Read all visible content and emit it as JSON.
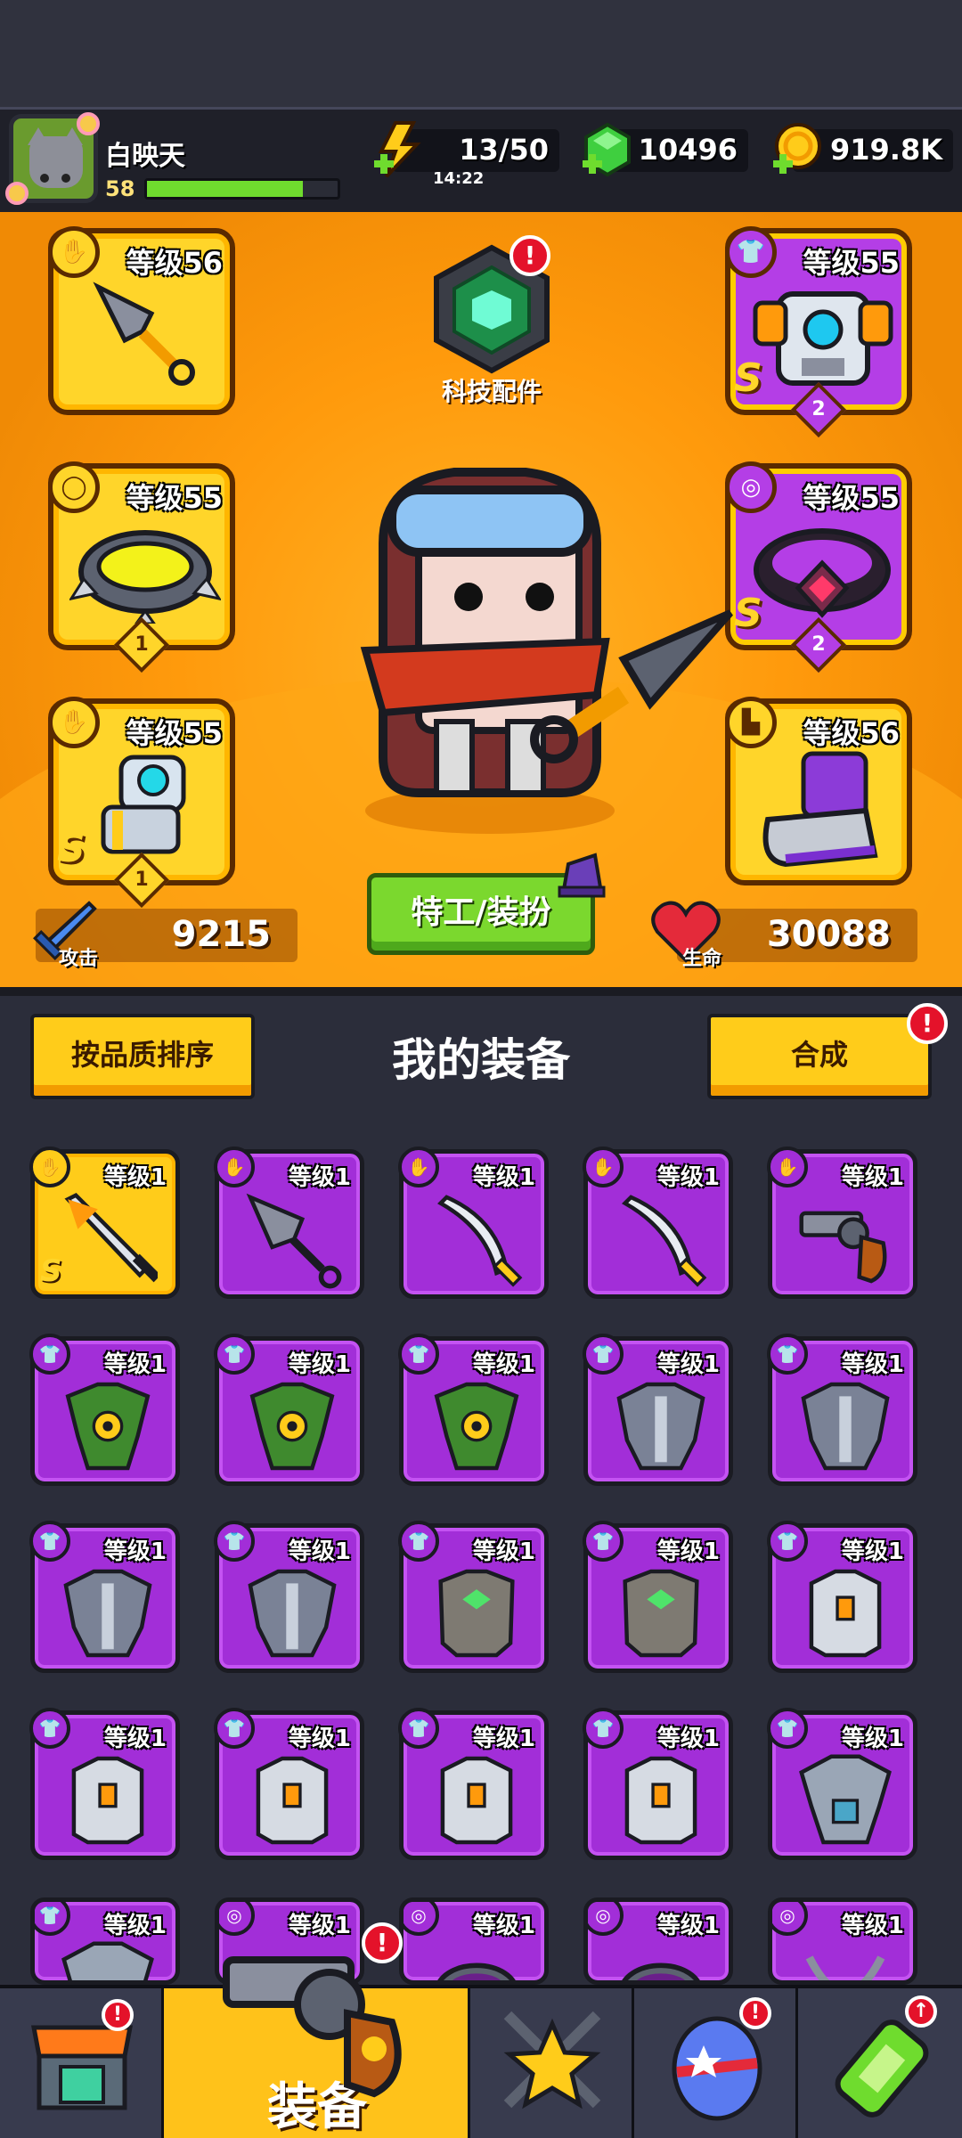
{
  "player": {
    "name": "白映天",
    "level": "58",
    "xp_progress": 0.82
  },
  "resources": {
    "energy": {
      "value": "13/50",
      "timer": "14:22",
      "icon": "lightning-icon"
    },
    "gems": {
      "value": "10496",
      "icon": "gem-icon"
    },
    "coins": {
      "value": "919.8K",
      "icon": "coin-icon"
    }
  },
  "equipped": {
    "weapon": {
      "level": "等级56",
      "icon": "kunai-icon"
    },
    "ring": {
      "level": "等级55",
      "icon": "spiked-ring-icon",
      "stars": "1"
    },
    "glove": {
      "level": "等级55",
      "icon": "gauntlet-icon",
      "rank": "S",
      "stars": "1"
    },
    "armor": {
      "level": "等级55",
      "icon": "mech-armor-icon",
      "rank": "S",
      "stars": "2"
    },
    "belt": {
      "level": "等级55",
      "icon": "gem-belt-icon",
      "rank": "S",
      "stars": "2"
    },
    "boots": {
      "level": "等级56",
      "icon": "boot-icon"
    }
  },
  "tech": {
    "label": "科技配件",
    "alert": "!"
  },
  "stats": {
    "attack_label": "攻击",
    "attack": "9215",
    "hp_label": "生命",
    "hp": "30088"
  },
  "agent_button": "特工/装扮",
  "inventory": {
    "sort_button": "按品质排序",
    "title": "我的装备",
    "merge_button": "合成",
    "merge_alert": "!",
    "items": [
      {
        "lv": "等级1",
        "icon": "sword-icon",
        "rank": "S",
        "quality": "gold"
      },
      {
        "lv": "等级1",
        "icon": "kunai-icon",
        "quality": "purple"
      },
      {
        "lv": "等级1",
        "icon": "scimitar-icon",
        "quality": "purple"
      },
      {
        "lv": "等级1",
        "icon": "scimitar-icon",
        "quality": "purple"
      },
      {
        "lv": "等级1",
        "icon": "revolver-icon",
        "quality": "purple"
      },
      {
        "lv": "等级1",
        "icon": "dragon-armor-icon",
        "quality": "purple"
      },
      {
        "lv": "等级1",
        "icon": "dragon-armor-icon",
        "quality": "purple"
      },
      {
        "lv": "等级1",
        "icon": "dragon-armor-icon",
        "quality": "purple"
      },
      {
        "lv": "等级1",
        "icon": "steel-armor-icon",
        "quality": "purple"
      },
      {
        "lv": "等级1",
        "icon": "steel-armor-icon",
        "quality": "purple"
      },
      {
        "lv": "等级1",
        "icon": "steel-armor-icon",
        "quality": "purple"
      },
      {
        "lv": "等级1",
        "icon": "steel-armor-icon",
        "quality": "purple"
      },
      {
        "lv": "等级1",
        "icon": "stone-armor-icon",
        "quality": "purple"
      },
      {
        "lv": "等级1",
        "icon": "stone-armor-icon",
        "quality": "purple"
      },
      {
        "lv": "等级1",
        "icon": "vest-icon",
        "quality": "purple"
      },
      {
        "lv": "等级1",
        "icon": "vest-icon",
        "quality": "purple"
      },
      {
        "lv": "等级1",
        "icon": "vest-icon",
        "quality": "purple"
      },
      {
        "lv": "等级1",
        "icon": "vest-icon",
        "quality": "purple"
      },
      {
        "lv": "等级1",
        "icon": "vest-icon",
        "quality": "purple"
      },
      {
        "lv": "等级1",
        "icon": "plate-armor-icon",
        "quality": "purple"
      },
      {
        "lv": "等级1",
        "icon": "plate-armor-icon",
        "quality": "purple"
      },
      {
        "lv": "等级1",
        "icon": "ring-icon",
        "quality": "purple"
      },
      {
        "lv": "等级1",
        "icon": "ring-icon",
        "quality": "purple"
      },
      {
        "lv": "等级1",
        "icon": "ring-icon",
        "quality": "purple"
      },
      {
        "lv": "等级1",
        "icon": "necklace-icon",
        "quality": "purple"
      }
    ]
  },
  "nav": {
    "tabs": [
      {
        "icon": "shop-icon",
        "alert": "!"
      },
      {
        "label": "装备",
        "icon": "revolver-icon",
        "alert": "!",
        "active": true
      },
      {
        "icon": "star-swords-icon"
      },
      {
        "icon": "egg-icon",
        "alert": "!"
      },
      {
        "icon": "dna-icon",
        "alert": "↑"
      }
    ]
  },
  "colors": {
    "orange": "#ff9a0c",
    "gold_slot": "#ffd52a",
    "purple_slot": "#a22ed8",
    "green_button": "#7bd82e",
    "alert_red": "#e4122a"
  }
}
